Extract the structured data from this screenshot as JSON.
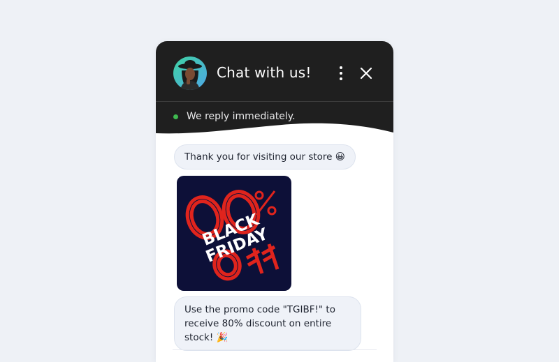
{
  "chat": {
    "title": "Chat with us!",
    "status": "We reply immediately.",
    "status_color": "#3fb950",
    "header_color": "#1f1f1f"
  },
  "icons": {
    "menu": "more-vertical-icon",
    "close": "close-icon"
  },
  "messages": [
    {
      "text": "Thank you for visiting our store",
      "emoji": "😀"
    },
    {
      "image_text": [
        "80%",
        "BLACK",
        "FRIDAY",
        "OFF"
      ]
    },
    {
      "text": "Use the promo code \"TGIBF!\" to receive 80% discount on entire stock!",
      "emoji": "🎉"
    }
  ]
}
